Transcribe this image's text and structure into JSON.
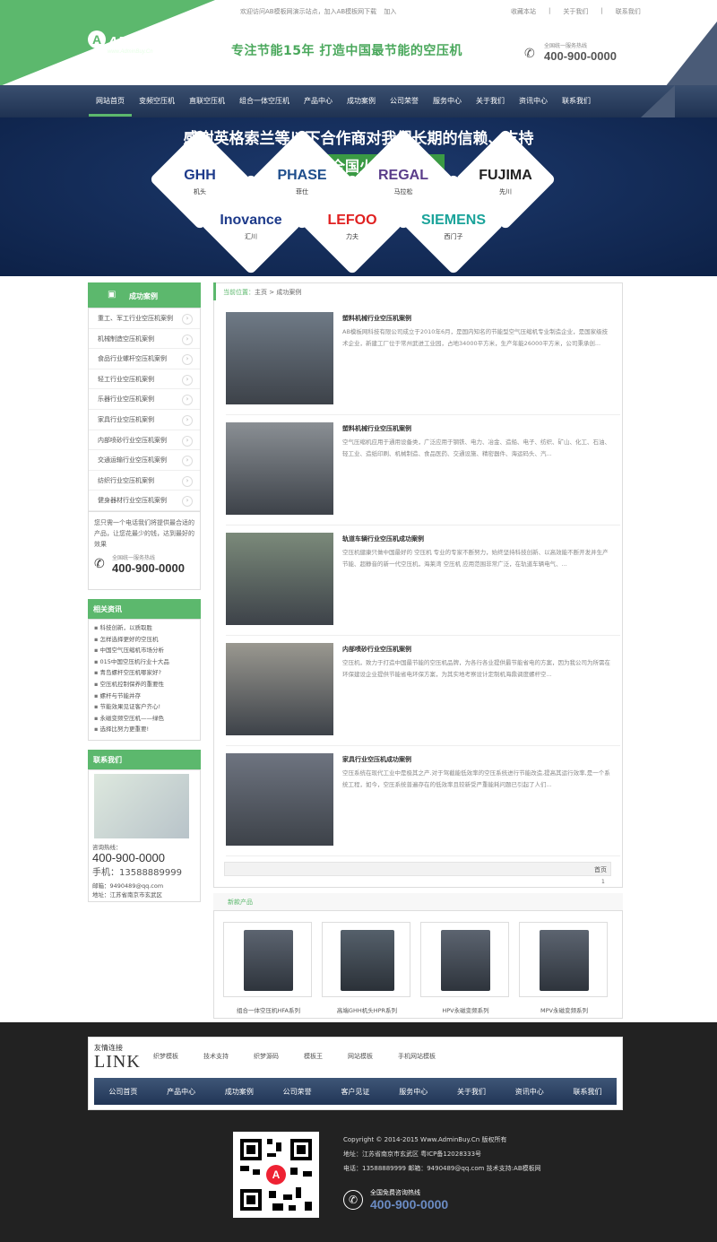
{
  "topbar": {
    "welcome": "欢迎访问AB模板网演示站点，加入AB模板网下载",
    "join": "加入",
    "fav": "收藏本站",
    "about": "关于我们",
    "contact": "联系我们"
  },
  "header": {
    "logo": "AB模板网",
    "logo_sub": "www.AdminBuy.Cn",
    "slogan": "专注节能15年 打造中国最节能的空压机",
    "hotline_label": "全国统一服务热线",
    "hotline": "400-900-0000"
  },
  "nav": [
    "网站首页",
    "变频空压机",
    "直联空压机",
    "组合一体空压机",
    "产品中心",
    "成功案例",
    "公司荣誉",
    "服务中心",
    "关于我们",
    "资讯中心",
    "联系我们"
  ],
  "banner": {
    "title": "感谢英格索兰等以下合作商对我们长期的信赖、支持",
    "subtitle": "现全国火热招商",
    "partners": [
      {
        "name": "GHH",
        "cn": "机头"
      },
      {
        "name": "PHASE",
        "cn": "菲仕"
      },
      {
        "name": "REGAL",
        "cn": "马拉松"
      },
      {
        "name": "FUJIMA",
        "cn": "先川"
      },
      {
        "name": "Inovance",
        "cn": "汇川"
      },
      {
        "name": "LEFOO",
        "cn": "力夫"
      },
      {
        "name": "SIEMENS",
        "cn": "西门子"
      }
    ]
  },
  "sidebar": {
    "cases_title": "成功案例",
    "cases": [
      "重工、军工行业空压机案例",
      "机械制造空压机案例",
      "食品行业螺杆空压机案例",
      "轻工行业空压机案例",
      "乐器行业空压机案例",
      "家具行业空压机案例",
      "内部喷砂行业空压机案例",
      "交通运输行业空压机案例",
      "纺织行业空压机案例",
      "健身器材行业空压机案例"
    ],
    "promo": "您只需一个电话我们将提供最合适的产品，让您花最少的钱，达到最好的效果",
    "promo_label": "全国统一服务热线",
    "promo_phone": "400-900-0000",
    "news_title": "相关资讯",
    "news": [
      "科技创新，以质取胜",
      "怎样选择更好的空压机",
      "中国空气压缩机市场分析",
      "015中国空压机行业十大品",
      "青岛螺杆空压机哪家好?",
      "空压机控制保养的重要性",
      "螺杆与节能并存",
      "节能效果见证客户齐心!",
      "永磁变频空压机——绿色",
      "选择比努力更重要!"
    ],
    "contact_title": "联系我们",
    "contact_hotline_label": "咨询热线：",
    "contact_hotline": "400-900-0000",
    "contact_mobile": "手机：13588889999",
    "contact_email": "邮箱：9490489@qq.com",
    "contact_addr": "地址：江苏省南京市玄武区"
  },
  "breadcrumb": {
    "label": "当前位置：",
    "home": "主页",
    "sep": ">",
    "current": "成功案例"
  },
  "cases": [
    {
      "title": "塑料机械行业空压机案例",
      "desc": "AB模板网科技有限公司成立于2010年6月，是国内知名的节能型空气压缩机专业制造企业，是国家级技术企业，新建工厂位于常州武进工业园，占地34000平方米，生产年能26000平方米，公司秉承创..."
    },
    {
      "title": "塑料机械行业空压机案例",
      "desc": "空气压缩机应用于通用设备类，广泛应用于钢铁、电力、冶金、造船、电子、纺织、矿山、化工、石油、轻工业、造纸印刷、机械制造、食品医药、交通设施、精密器件、海运码头、汽..."
    },
    {
      "title": "轨道车辆行业空压机成功案例",
      "desc": "空压机健康只做中国最好的 空压机 专业的专家不断努力，始终坚持科技创新、以高效能不断开发并生产节能、超静音的新一代空压机，海莱湾 空压机 应用范围非常广泛，在轨道车辆电气、..."
    },
    {
      "title": "内部喷砂行业空压机案例",
      "desc": "空压机，致力于打造中国最节能的空压机品牌，为各行各业提供最节能省电的方案，因为我公司为所需在环保建设企业提供节能省电环保方案，为其实地考察设计定制机海鼎调度螺杆空..."
    },
    {
      "title": "家具行业空压机成功案例",
      "desc": "空压系统在现代工业中是极其之产.对于驾截能低效率的空压系统进行节能改造,提高其运行效率,是一个系统工程，如今，空压系统普遍存在的低效率且较新受严重能耗问题已引起了人们..."
    }
  ],
  "pager": {
    "last": "首页",
    "count": "1"
  },
  "products_title": "新款产品",
  "products": [
    "组合一体空压机HFA系列",
    "高端GHH机头HPR系列",
    "HPV永磁变频系列",
    "MPV永磁变频系列"
  ],
  "footer": {
    "links_title": "友情连接",
    "links_big": "LINK",
    "links": [
      "织梦模板",
      "技术支持",
      "织梦源码",
      "模板王",
      "网站模板",
      "手机网站模板"
    ],
    "nav": [
      "公司首页",
      "产品中心",
      "成功案例",
      "公司荣誉",
      "客户见证",
      "服务中心",
      "关于我们",
      "资讯中心",
      "联系我们"
    ],
    "copyright": "Copyright © 2014-2015 Www.AdminBuy.Cn 版权所有",
    "address": "地址：江苏省南京市玄武区 粤ICP备12028333号",
    "tel": "电话：13588889999 邮箱：9490489@qq.com 技术支持:AB模板网",
    "free_label": "全国免费咨询热线",
    "free_phone": "400-900-0000"
  },
  "colors": {
    "green": "#5cb86d",
    "navy": "#1f3252",
    "dark": "#222222"
  }
}
